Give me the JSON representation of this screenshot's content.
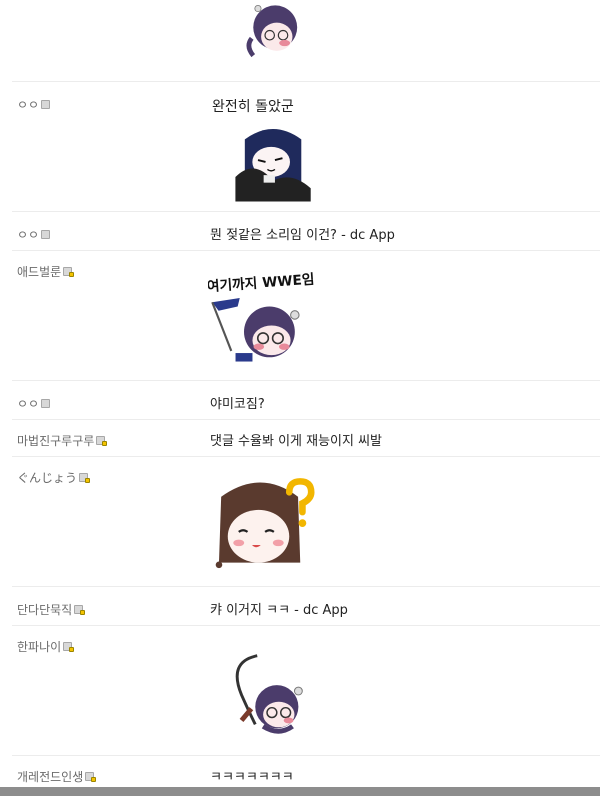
{
  "comments": [
    {
      "nickname": "ㅇㅇ",
      "badge": "plain",
      "text": "완전히 돌았군",
      "sticker": "navy-hair-eating-sticker"
    },
    {
      "nickname": "ㅇㅇ",
      "badge": "plain",
      "text": "뭔 젖같은 소리임 이건? - dc App",
      "sticker": ""
    },
    {
      "nickname": "애드벌룬",
      "badge": "lock",
      "text": "",
      "sticker": "wwe-sticker",
      "sticker_text": "여기까지 WWE임"
    },
    {
      "nickname": "ㅇㅇ",
      "badge": "plain",
      "text": "야미코짐?",
      "sticker": ""
    },
    {
      "nickname": "마법진구루구루",
      "badge": "lock",
      "text": "댓글 수율봐 이게 재능이지 씨발",
      "sticker": ""
    },
    {
      "nickname": "ぐんじょう",
      "badge": "lock",
      "text": "",
      "sticker": "question-mark-girl-sticker"
    },
    {
      "nickname": "단다단묵직",
      "badge": "lock",
      "text": "캬 이거지 ㅋㅋ - dc App",
      "sticker": ""
    },
    {
      "nickname": "한파나이",
      "badge": "lock",
      "text": "",
      "sticker": "whip-sticker"
    },
    {
      "nickname": "개레전드인생",
      "badge": "lock",
      "text": "ㅋㅋㅋㅋㅋㅋㅋ",
      "sticker": ""
    }
  ],
  "colors": {
    "divider": "#ececec",
    "nickname": "#6b6b6b",
    "text": "#222222",
    "bar": "#8d8d8d"
  }
}
